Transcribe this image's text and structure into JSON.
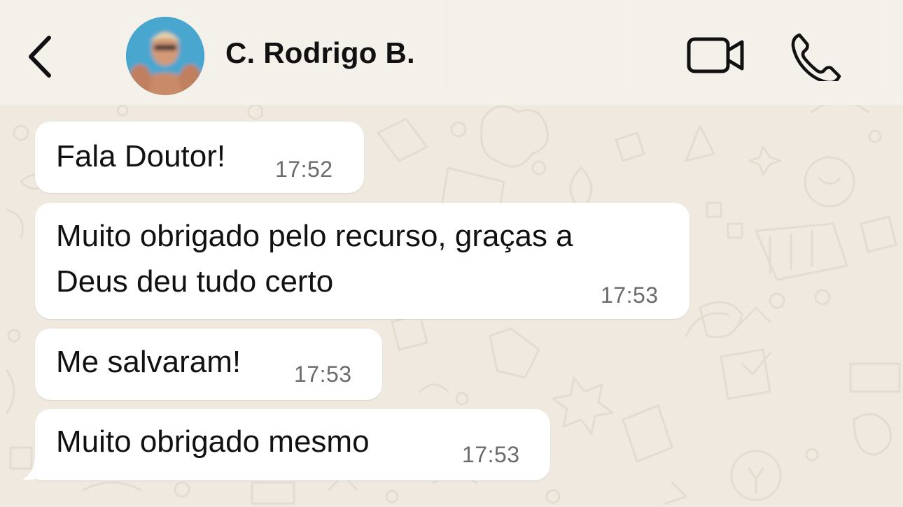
{
  "header": {
    "contact_name": "C. Rodrigo B.",
    "back_icon": "chevron-left-icon",
    "video_icon": "video-camera-icon",
    "call_icon": "phone-icon"
  },
  "messages": [
    {
      "text": "Fala Doutor!",
      "time": "17:52"
    },
    {
      "lines": [
        "Muito obrigado pelo recurso, graças a",
        "Deus deu tudo certo"
      ],
      "time": "17:53"
    },
    {
      "text": "Me salvaram!",
      "time": "17:53"
    },
    {
      "text": "Muito obrigado mesmo",
      "time": "17:53"
    }
  ],
  "colors": {
    "background": "#efe9df",
    "bubble": "#ffffff",
    "timestamp": "#6b6b6b"
  }
}
